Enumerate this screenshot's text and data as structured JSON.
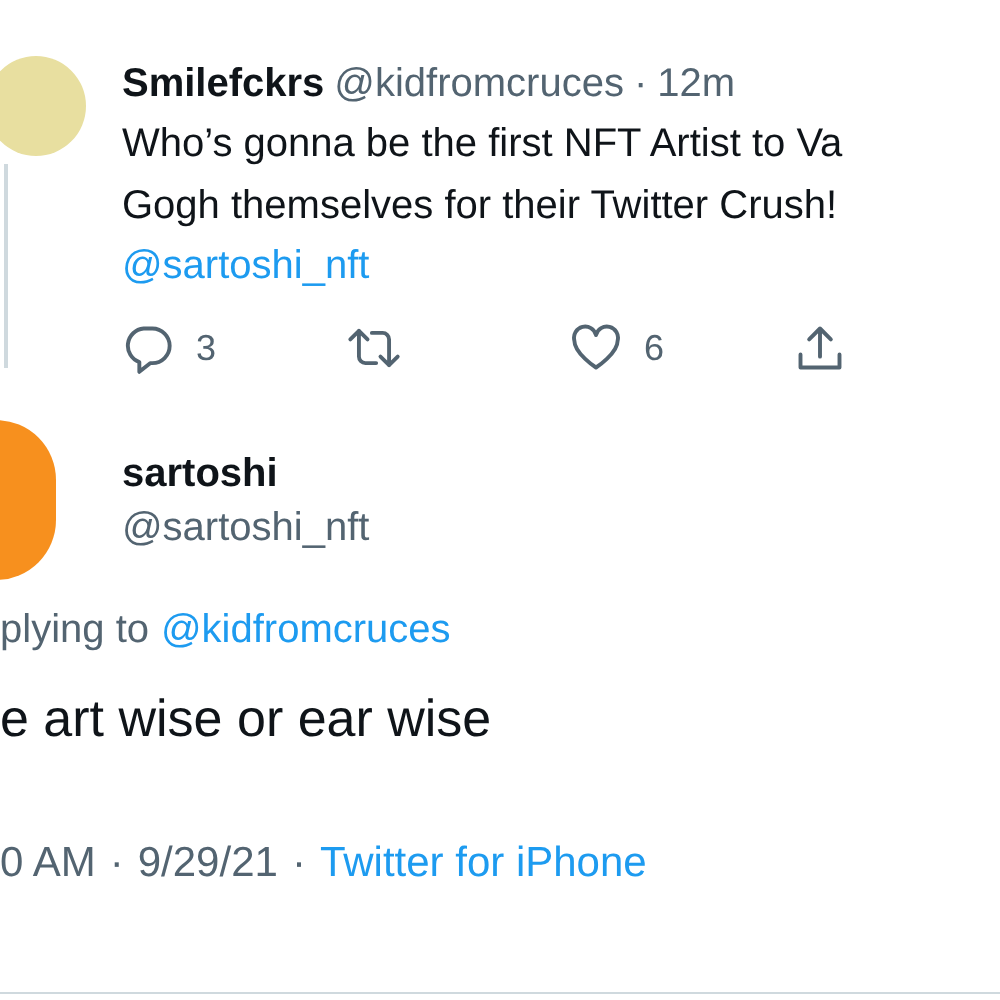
{
  "tweet": {
    "author": {
      "name": "Smilefckrs",
      "handle": "@kidfromcruces"
    },
    "separator": "·",
    "time": "12m",
    "text_lines": [
      "Who’s gonna be the first NFT Artist to Va",
      "Gogh themselves for their Twitter Crush!"
    ],
    "mention": "@sartoshi_nft",
    "actions": [
      {
        "kind": "reply",
        "count": "3"
      },
      {
        "kind": "retweet"
      },
      {
        "kind": "like",
        "count": "6"
      },
      {
        "kind": "share"
      }
    ]
  },
  "reply": {
    "author": {
      "name": "sartoshi",
      "handle": "@sartoshi_nft"
    },
    "replying_to": {
      "label": "plying to",
      "mention": "@kidfromcruces"
    },
    "text": "e art wise or ear wise",
    "timestamp": {
      "time": "0 AM",
      "separator_1": "·",
      "date": "9/29/21",
      "separator_2": "·",
      "source": "Twitter for iPhone"
    }
  }
}
